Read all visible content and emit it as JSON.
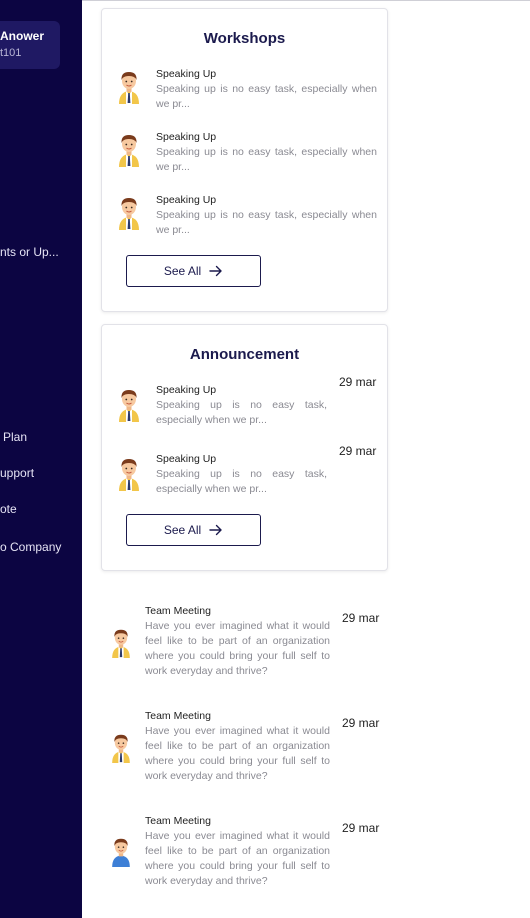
{
  "sidebar": {
    "user_name": "Anower",
    "user_id": "t101",
    "items": [
      {
        "label": "nts or Up..."
      },
      {
        "label": "Plan"
      },
      {
        "label": "upport"
      },
      {
        "label": "ote"
      },
      {
        "label": "o Company"
      }
    ]
  },
  "workshops": {
    "title": "Workshops",
    "items": [
      {
        "title": "Speaking Up",
        "body": "Speaking up is no easy task, especially when we pr..."
      },
      {
        "title": "Speaking Up",
        "body": "Speaking up is no easy task, especially when we pr..."
      },
      {
        "title": "Speaking Up",
        "body": "Speaking up is no easy task, especially when we pr..."
      }
    ],
    "see_all_label": "See All"
  },
  "announcement": {
    "title": "Announcement",
    "items": [
      {
        "title": "Speaking Up",
        "body": "Speaking up is no easy task, especially when we pr...",
        "date": "29 mar"
      },
      {
        "title": "Speaking Up",
        "body": "Speaking up is no easy task, especially when we pr...",
        "date": "29 mar"
      }
    ],
    "see_all_label": "See All"
  },
  "meetings": [
    {
      "title": "Team Meeting",
      "body": "Have you ever imagined what it would feel like to be part of an organization where you could bring your full self to work everyday and thrive?",
      "date": "29 mar",
      "avatar": "male-avatar-yellow"
    },
    {
      "title": "Team Meeting",
      "body": "Have you ever imagined what it would feel like to be part of an organization where you could bring your full self to work everyday and thrive?",
      "date": "29 mar",
      "avatar": "male-avatar-yellow"
    },
    {
      "title": "Team Meeting",
      "body": "Have you ever imagined what it would feel like to be part of an organization where you could bring your full self to work everyday and thrive?",
      "date": "29 mar",
      "avatar": "male-avatar-blue"
    }
  ],
  "colors": {
    "sidebar_bg": "#0c0542",
    "heading": "#1b1a4d",
    "avatar_yellow": "#f2c64a",
    "avatar_blue": "#3d7fd6"
  }
}
